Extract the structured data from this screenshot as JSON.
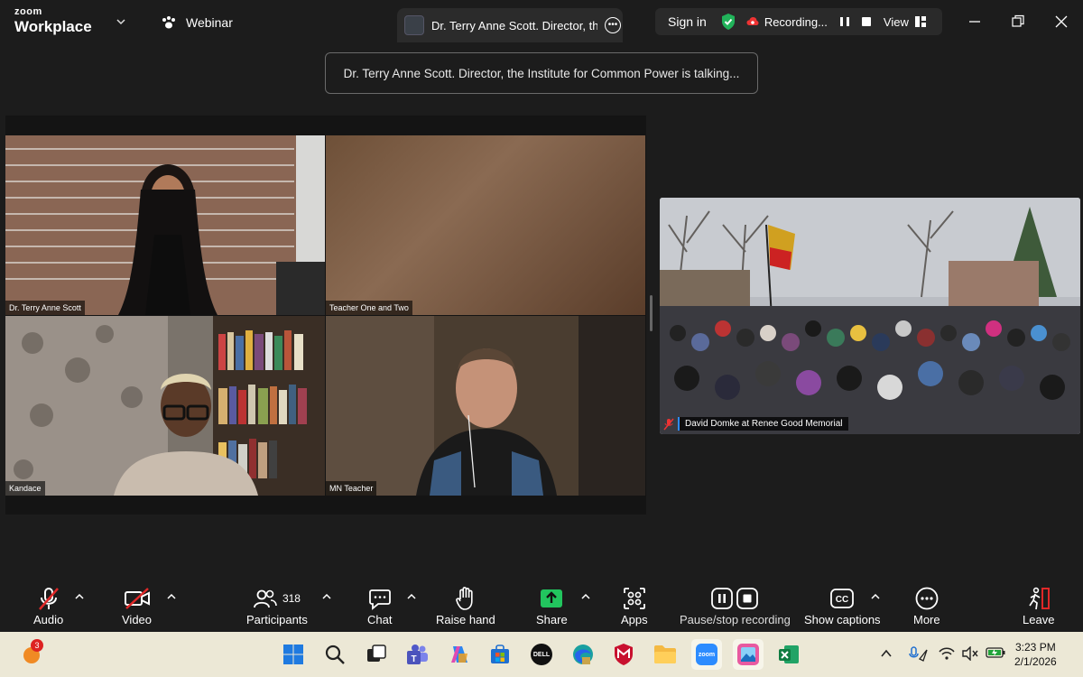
{
  "app": {
    "logo_line1": "zoom",
    "logo_line2": "Workplace",
    "mode_label": "Webinar"
  },
  "speaker_tab": {
    "text": "Dr. Terry Anne Scott.  Director, th"
  },
  "header": {
    "signin_label": "Sign in",
    "recording_label": "Recording...",
    "view_label": "View"
  },
  "banner": {
    "text": "Dr. Terry Anne Scott.  Director, the Institute for Common Power is talking..."
  },
  "tiles": [
    {
      "name": "Dr. Terry Anne Scott"
    },
    {
      "name": "Teacher One and Two"
    },
    {
      "name": "Kandace"
    },
    {
      "name": "MN Teacher"
    }
  ],
  "share": {
    "label": "David Domke at Renee Good Memorial"
  },
  "toolbar": {
    "audio": "Audio",
    "video": "Video",
    "participants": "Participants",
    "participants_count": "318",
    "chat": "Chat",
    "raise_hand": "Raise hand",
    "share": "Share",
    "apps": "Apps",
    "recording": "Pause/stop recording",
    "captions": "Show captions",
    "more": "More",
    "leave": "Leave"
  },
  "taskbar": {
    "badge_count": "3",
    "dell_label": "DELL",
    "zoom_label": "zoom",
    "time": "3:23 PM",
    "date": "2/1/2026"
  },
  "colors": {
    "accent_blue": "#2d8cff",
    "shield_green": "#21b35a",
    "share_green": "#22c55e",
    "leave_red": "#e02828",
    "taskbar_bg": "#ece8d6"
  }
}
